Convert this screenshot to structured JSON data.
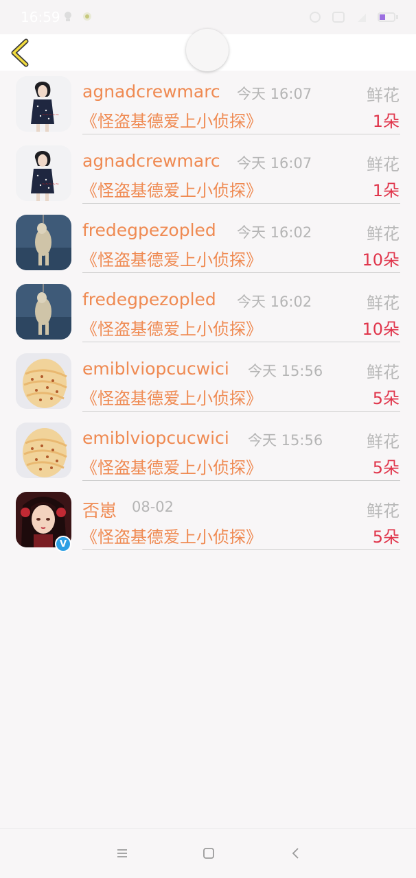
{
  "status_bar": {
    "time": "16:59"
  },
  "colors": {
    "username": "#ef8a52",
    "amount": "#e0354b",
    "muted": "#b5b5b5"
  },
  "rows": [
    {
      "username": "agnadcrewmarc",
      "time": "今天 16:07",
      "gift_type": "鲜花",
      "book": "《怪盗基德爱上小侦探》",
      "amount": "1朵",
      "avatar": "woman-dress",
      "verified": false
    },
    {
      "username": "agnadcrewmarc",
      "time": "今天 16:07",
      "gift_type": "鲜花",
      "book": "《怪盗基德爱上小侦探》",
      "amount": "1朵",
      "avatar": "woman-dress",
      "verified": false
    },
    {
      "username": "fredegpezopled",
      "time": "今天 16:02",
      "gift_type": "鲜花",
      "book": "《怪盗基德爱上小侦探》",
      "amount": "10朵",
      "avatar": "standing-dog",
      "verified": false
    },
    {
      "username": "fredegpezopled",
      "time": "今天 16:02",
      "gift_type": "鲜花",
      "book": "《怪盗基德爱上小侦探》",
      "amount": "10朵",
      "avatar": "standing-dog",
      "verified": false
    },
    {
      "username": "emiblviopcucwici",
      "time": "今天 15:56",
      "gift_type": "鲜花",
      "book": "《怪盗基德爱上小侦探》",
      "amount": "5朵",
      "avatar": "seashell",
      "verified": false
    },
    {
      "username": "emiblviopcucwici",
      "time": "今天 15:56",
      "gift_type": "鲜花",
      "book": "《怪盗基德爱上小侦探》",
      "amount": "5朵",
      "avatar": "seashell",
      "verified": false
    },
    {
      "username": "否崽",
      "time": "08-02",
      "gift_type": "鲜花",
      "book": "《怪盗基德爱上小侦探》",
      "amount": "5朵",
      "avatar": "anime-girl",
      "verified": true,
      "badge": "V"
    }
  ]
}
